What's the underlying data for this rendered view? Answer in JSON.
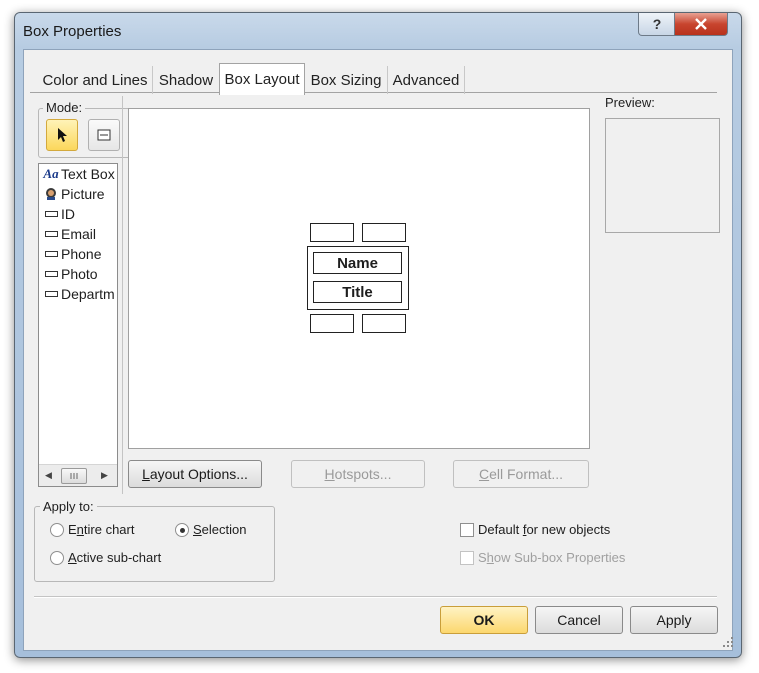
{
  "window": {
    "title": "Box Properties"
  },
  "tabs": [
    {
      "label": "Color and Lines"
    },
    {
      "label": "Shadow"
    },
    {
      "label": "Box Layout"
    },
    {
      "label": "Box Sizing"
    },
    {
      "label": "Advanced"
    }
  ],
  "mode": {
    "label": "Mode:"
  },
  "field_list": [
    {
      "label": "Text Box",
      "icon": "text-box-icon"
    },
    {
      "label": "Picture",
      "icon": "picture-icon"
    },
    {
      "label": "ID",
      "icon": "field-icon"
    },
    {
      "label": "Email",
      "icon": "field-icon"
    },
    {
      "label": "Phone",
      "icon": "field-icon"
    },
    {
      "label": "Photo",
      "icon": "field-icon"
    },
    {
      "label": "Departm",
      "icon": "field-icon"
    }
  ],
  "layout": {
    "name_label": "Name",
    "title_label": "Title"
  },
  "buttons": {
    "layout_options": {
      "pre": "",
      "u": "L",
      "post": "ayout Options..."
    },
    "hotspots": {
      "pre": "",
      "u": "H",
      "post": "otspots..."
    },
    "cell_format": {
      "pre": "",
      "u": "C",
      "post": "ell Format..."
    },
    "ok": "OK",
    "cancel": "Cancel",
    "apply": "Apply"
  },
  "preview": {
    "label": "Preview:"
  },
  "apply_to": {
    "label": "Apply to:",
    "entire_chart": {
      "pre": "E",
      "u": "n",
      "post": "tire chart"
    },
    "selection": {
      "pre": "",
      "u": "S",
      "post": "election"
    },
    "active_sub_chart": {
      "pre": "",
      "u": "A",
      "post": "ctive sub-chart"
    },
    "selected": "Selection"
  },
  "options": {
    "default_new": {
      "pre": "Default ",
      "u": "f",
      "post": "or new objects"
    },
    "show_sub_box": {
      "pre": "S",
      "u": "h",
      "post": "ow Sub-box Properties"
    }
  },
  "colors": {
    "ok_button": "#fcd76e",
    "selected_mode": "#fbd75b"
  }
}
